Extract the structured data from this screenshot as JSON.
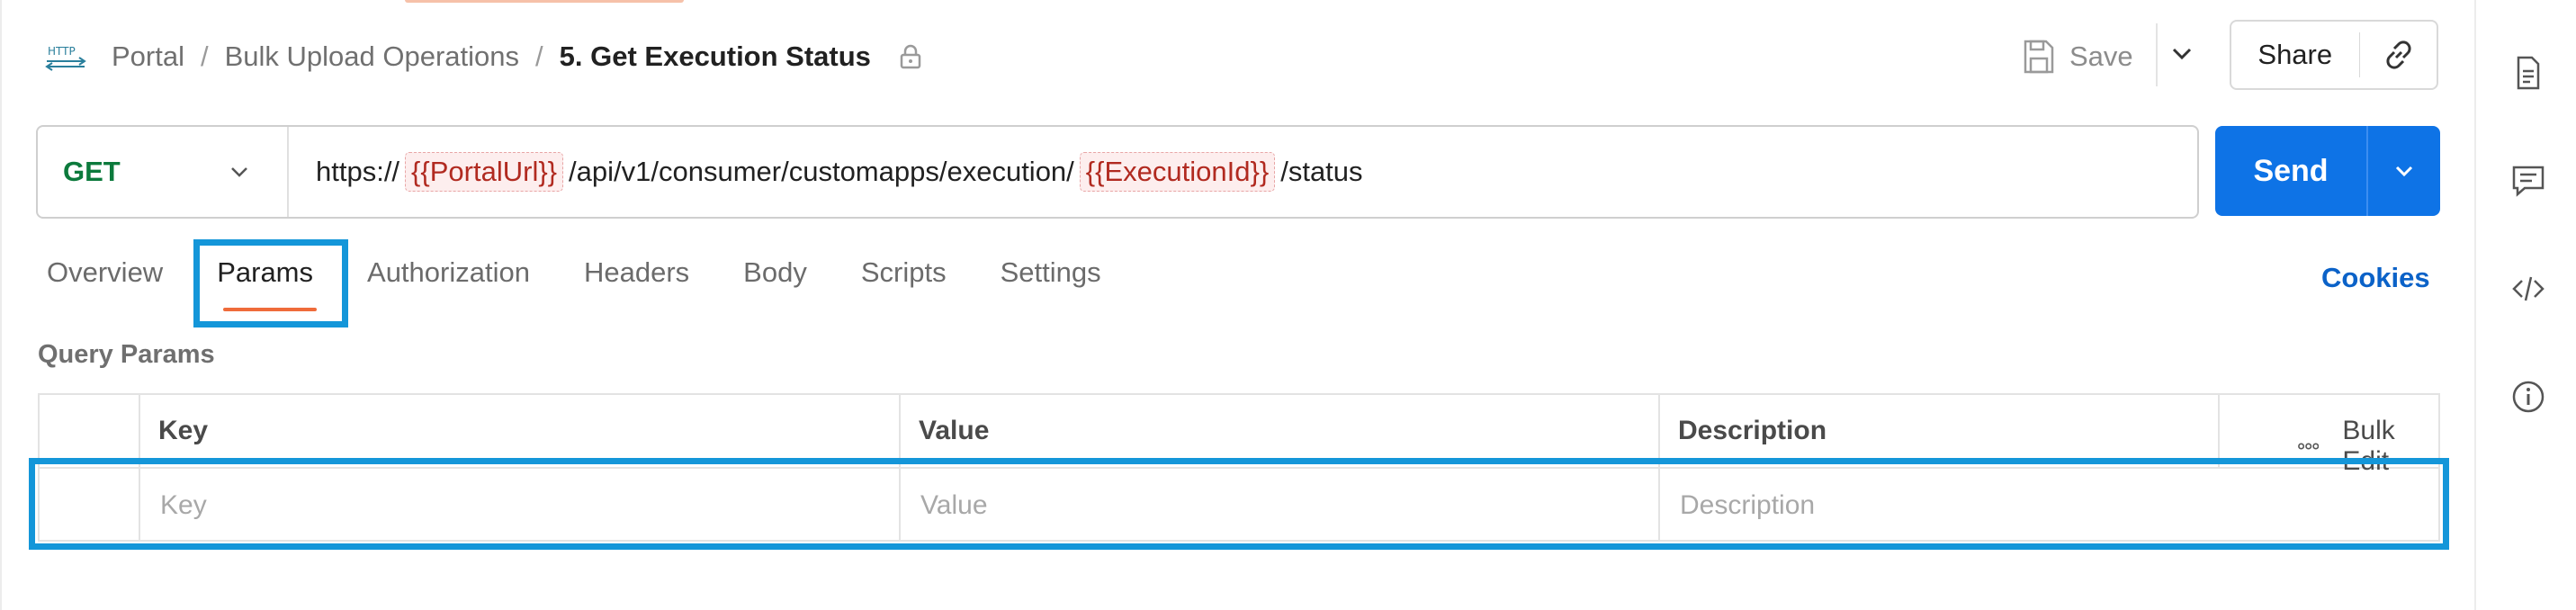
{
  "breadcrumb": {
    "items": [
      "Portal",
      "Bulk Upload Operations"
    ],
    "separator": "/",
    "current": "5. Get Execution Status",
    "http_icon_text": "HTTP"
  },
  "toolbar": {
    "save_label": "Save",
    "share_label": "Share"
  },
  "request": {
    "method": "GET",
    "url_parts": {
      "prefix": "https://",
      "var1": "{{PortalUrl}}",
      "middle": "/api/v1/consumer/customapps/execution/",
      "var2": "{{ExecutionId}}",
      "suffix": "/status"
    },
    "send_label": "Send"
  },
  "tabs": [
    {
      "label": "Overview"
    },
    {
      "label": "Params"
    },
    {
      "label": "Authorization"
    },
    {
      "label": "Headers"
    },
    {
      "label": "Body"
    },
    {
      "label": "Scripts"
    },
    {
      "label": "Settings"
    }
  ],
  "active_tab": "Params",
  "cookies_label": "Cookies",
  "query_params": {
    "title": "Query Params",
    "headers": {
      "key": "Key",
      "value": "Value",
      "description": "Description",
      "bulk_edit": "Bulk Edit"
    },
    "placeholders": {
      "key": "Key",
      "value": "Value",
      "description": "Description"
    }
  },
  "right_rail_icons": [
    "document-icon",
    "comment-icon",
    "code-icon",
    "info-icon"
  ],
  "colors": {
    "accent": "#0e73e6",
    "method_get": "#0c7a3c",
    "variable": "#b12a20",
    "tab_underline": "#ef6b3a",
    "highlight": "#1496d9",
    "link": "#0b62c8"
  }
}
